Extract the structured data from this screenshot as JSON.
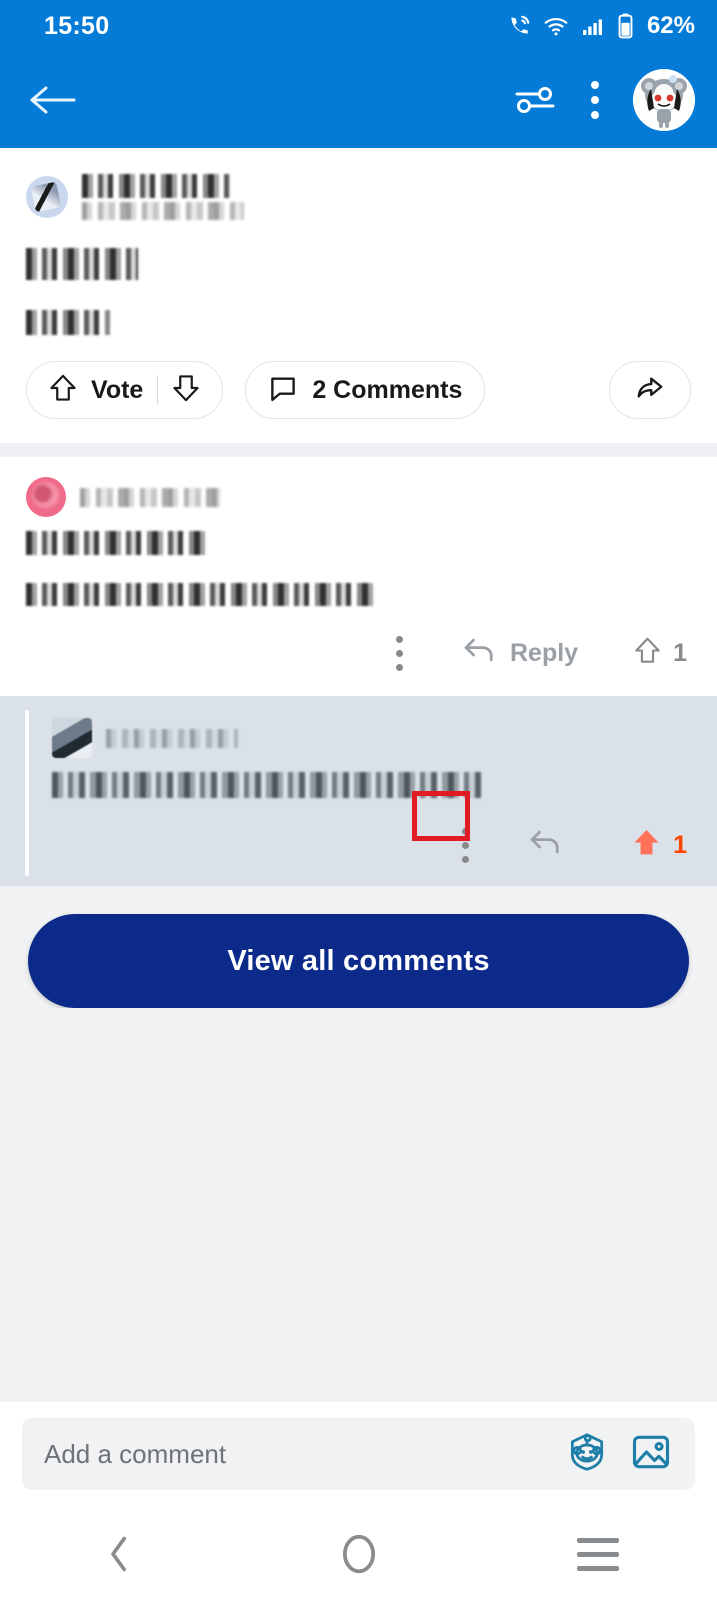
{
  "status_bar": {
    "time": "15:50",
    "battery_percent": "62%",
    "icons": [
      "call-waves-icon",
      "wifi-icon",
      "cellular-signal-icon",
      "battery-icon"
    ]
  },
  "app_bar": {
    "back_label": "Back",
    "sort_label": "Sort and filter",
    "overflow_label": "More options",
    "avatar_label": "Profile avatar",
    "background_color": "#057BD8"
  },
  "post": {
    "subreddit_redacted": true,
    "subreddit_name": "",
    "subreddit_meta": "",
    "title": "",
    "body": "",
    "vote_label": "Vote",
    "comments_label": "2 Comments",
    "share_label": "Share"
  },
  "comments": [
    {
      "author": "",
      "avatar_type": "pink-avatar",
      "line1": "",
      "line2": "",
      "reply_label": "Reply",
      "vote_count": "1",
      "upvoted": false,
      "highlighted": false
    },
    {
      "author": "",
      "avatar_type": "photo-avatar",
      "line1": "",
      "line2": "",
      "reply_label": "",
      "vote_count": "1",
      "upvoted": true,
      "highlighted": true
    }
  ],
  "annotation": {
    "type": "red-highlight-box",
    "target": "comment-overflow-menu",
    "color": "#e01b24"
  },
  "view_all_button": {
    "label": "View all comments",
    "color": "#0b2a8a"
  },
  "composer": {
    "placeholder": "Add a comment",
    "avatar_icon": "snoo-avatar-icon",
    "image_icon": "image-attach-icon",
    "accent_color": "#1d7ea8"
  },
  "nav_bar": {
    "back_label": "Back",
    "home_label": "Home",
    "recents_label": "Recent apps"
  },
  "colors": {
    "app_bar_blue": "#057BD8",
    "highlight_row": "#dbe1e8",
    "page_background": "#f0f2f4",
    "upvote_orange": "#ff4500"
  }
}
